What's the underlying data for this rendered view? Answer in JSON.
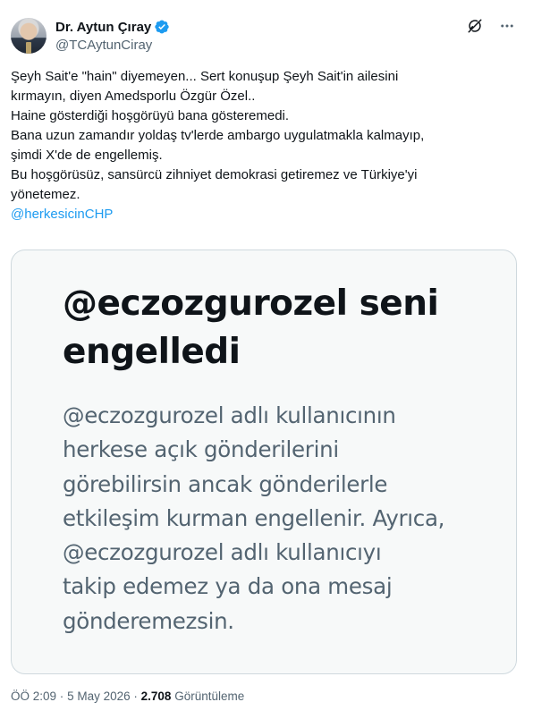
{
  "author": {
    "name": "Dr. Aytun Çıray",
    "handle": "@TCAytunCiray",
    "verified": true
  },
  "header_icons": [
    "grok-icon",
    "more-icon"
  ],
  "tweet": {
    "lines": [
      "Şeyh Sait'e \"hain\" diyemeyen... Sert konuşup Şeyh Sait'in ailesini",
      "kırmayın, diyen Amedsporlu Özgür Özel..",
      "Haine gösterdiği hoşgörüyü bana gösteremedi.",
      "Bana uzun zamandır yoldaş tv'lerde ambargo uygulatmakla kalmayıp,",
      "şimdi X'de de engellemiş.",
      "Bu hoşgörüsüz, sansürcü zihniyet demokrasi getiremez ve Türkiye'yi",
      "yönetemez."
    ],
    "mention": "@herkesicinCHP"
  },
  "media": {
    "title_lines": [
      "@eczozgurozel seni",
      "engelledi"
    ],
    "body_lines": [
      "@eczozgurozel adlı kullanıcının",
      "herkese açık gönderilerini",
      "görebilirsin ancak gönderilerle",
      "etkileşim kurman engellenir. Ayrıca,",
      "@eczozgurozel adlı kullanıcıyı",
      "takip edemez ya da ona mesaj",
      "gönderemezsin."
    ]
  },
  "footer": {
    "time": "ÖÖ 2:09",
    "separator": "·",
    "date": "5 May 2026",
    "views_count": "2.708",
    "views_label": "Görüntüleme"
  },
  "colors": {
    "accent": "#1d9bf0",
    "text": "#0f1419",
    "secondary": "#536471"
  }
}
